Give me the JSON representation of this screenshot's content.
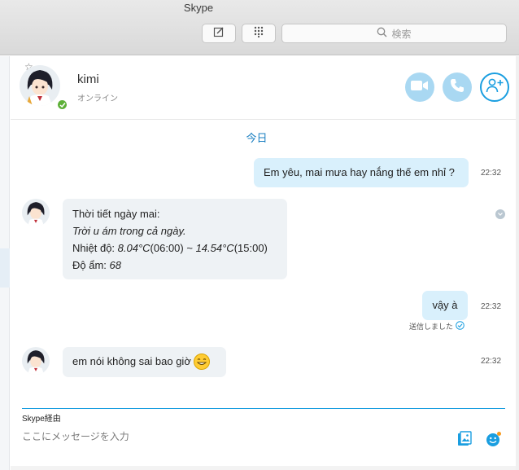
{
  "window": {
    "title": "Skype"
  },
  "toolbar": {
    "compose_icon": "compose-icon",
    "dialpad_icon": "dialpad-icon",
    "search_placeholder": "検索"
  },
  "contact": {
    "name": "kimi",
    "status": "オンライン",
    "status_color": "#5db038"
  },
  "header_actions": {
    "video": "video-icon",
    "call": "phone-icon",
    "add": "add-person-icon",
    "accent": "#1a9ee0"
  },
  "chat": {
    "date_label": "今日",
    "msg1": {
      "text": "Em yêu, mai mưa hay nắng thế em nhỉ ?",
      "time": "22:32"
    },
    "msg2": {
      "line1": "Thời tiết ngày mai:",
      "line2": "Trời u ám trong cả ngày.",
      "humidity_label": "Nhiệt độ: ",
      "t1": "8.04°C",
      "t1_time": "(06:00) ~ ",
      "t2": "14.54°C",
      "t2_time": "(15:00)",
      "hum_label": "Độ ẩm: ",
      "hum_value": "68"
    },
    "msg3": {
      "text": "vậy à",
      "time": "22:32",
      "receipt": "送信しました"
    },
    "msg4": {
      "text": "em nói không sai bao giờ",
      "time": "22:32"
    }
  },
  "composer": {
    "via": "Skype経由",
    "placeholder": "ここにメッセージを入力",
    "media_icon": "media-icon",
    "emoji_icon": "emoticon-icon"
  }
}
